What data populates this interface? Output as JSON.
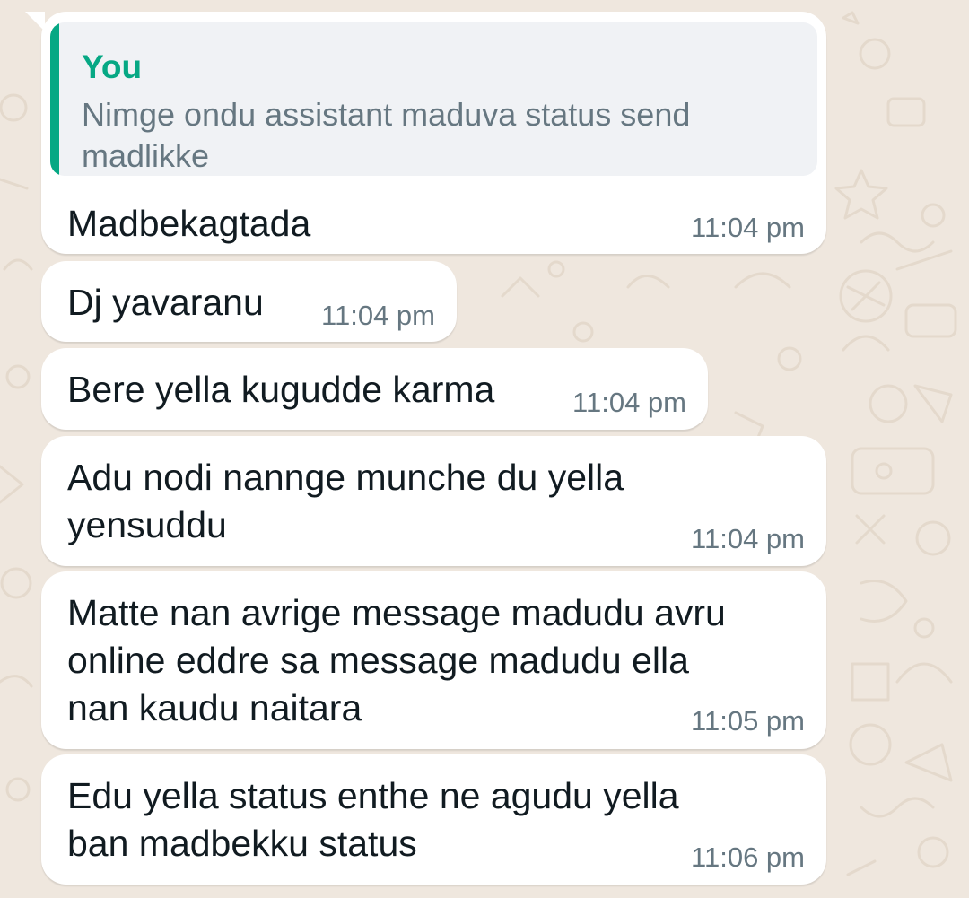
{
  "chat": {
    "quoted": {
      "author": "You",
      "text": "Nimge ondu assistant maduva status send madlikke"
    },
    "messages": [
      {
        "text": "Madbekagtada",
        "time": "11:04 pm"
      },
      {
        "text": "Dj yavaranu",
        "time": "11:04 pm"
      },
      {
        "text": "Bere yella kugudde karma",
        "time": "11:04 pm"
      },
      {
        "text": "Adu nodi nannge munche du yella\nyensuddu",
        "time": "11:04 pm"
      },
      {
        "text": "Matte nan avrige message madudu avru\nonline eddre sa message madudu ella\nnan kaudu naitara",
        "time": "11:05 pm"
      },
      {
        "text": "Edu yella status enthe ne agudu yella\nban madbekku status",
        "time": "11:06 pm"
      }
    ]
  },
  "colors": {
    "wallpaper": "#efe7de",
    "bubble": "#ffffff",
    "quote_accent": "#06a884",
    "quote_background": "#f0f2f5",
    "message_text": "#111b21",
    "timestamp": "#667781"
  }
}
